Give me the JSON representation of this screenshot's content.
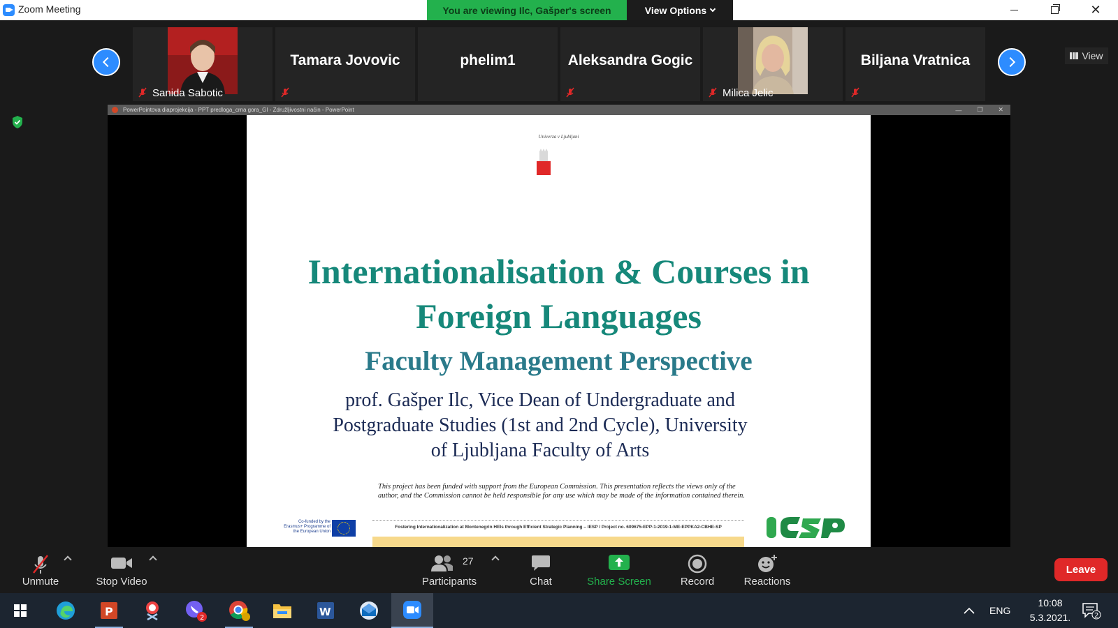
{
  "window": {
    "title": "Zoom Meeting",
    "viewing_banner": "You are viewing Ilc, Gašper's screen",
    "view_options": "View Options"
  },
  "participants_strip": {
    "tiles": [
      {
        "name": "Sanida Sabotic",
        "has_video": true,
        "muted": true
      },
      {
        "name": "Tamara Jovovic",
        "has_video": false,
        "muted": true
      },
      {
        "name": "phelim1",
        "has_video": false,
        "muted": false
      },
      {
        "name": "Aleksandra Gogic",
        "has_video": false,
        "muted": true
      },
      {
        "name": "Milica Jelic",
        "has_video": true,
        "muted": true
      },
      {
        "name": "Biljana Vratnica",
        "has_video": false,
        "muted": true
      }
    ],
    "view_label": "View"
  },
  "shared_screen": {
    "window_title": "PowerPointova diaprojekcija  -  PPT predloga_crna gora_GI  -  Združljivostni način - PowerPoint",
    "slide": {
      "university": "Univerza v Ljubljani",
      "title_line1": "Internationalisation & Courses in",
      "title_line2": "Foreign Languages",
      "subtitle": "Faculty Management Perspective",
      "author_line1": "prof. Gašper Ilc, Vice Dean of Undergraduate and",
      "author_line2": "Postgraduate Studies (1st and 2nd Cycle), University",
      "author_line3": "of Ljubljana Faculty of Arts",
      "disclaimer": "This project has been funded with support from the European Commission. This presentation reflects the views only of the author, and the Commission cannot be held responsible for any use which may be made of the information contained therein.",
      "eu_label": "Co-funded by the Erasmus+ Programme of the European Union",
      "footer": "Fostering Internationalization at Montenegrin HEIs through Efficient Strategic Planning – IESP / Project no. 609675-EPP-1-2019-1-ME-EPPKA2-CBHE-SP",
      "logo_text": "IESP"
    }
  },
  "toolbar": {
    "unmute": "Unmute",
    "stop_video": "Stop Video",
    "participants": "Participants",
    "participant_count": "27",
    "chat": "Chat",
    "share_screen": "Share Screen",
    "record": "Record",
    "reactions": "Reactions",
    "leave": "Leave"
  },
  "taskbar": {
    "language": "ENG",
    "time": "10:08",
    "date": "5.3.2021.",
    "notification_count": "2",
    "viber_badge": "2"
  },
  "colors": {
    "zoom_blue": "#2d8cff",
    "banner_green": "#23b14d",
    "leave_red": "#e02828",
    "slide_title": "#16887a"
  }
}
